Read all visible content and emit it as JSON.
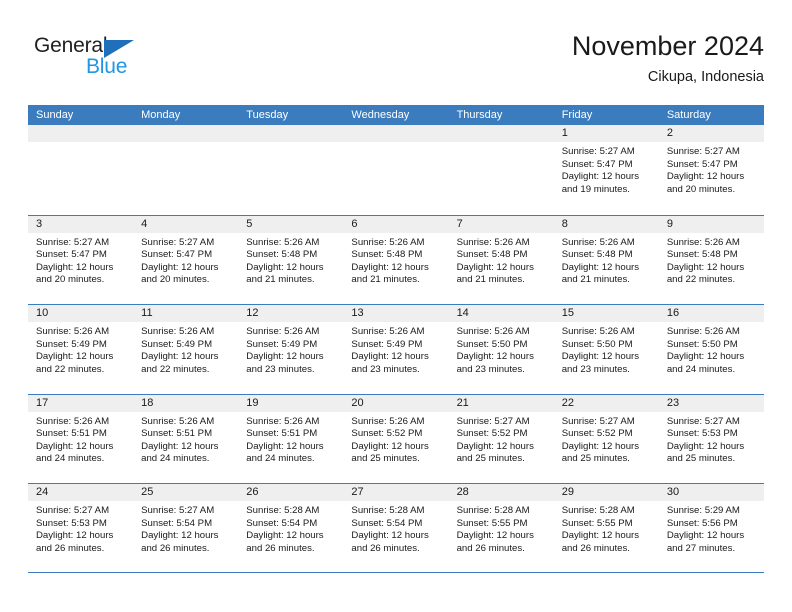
{
  "brand": {
    "name_part1": "General",
    "name_part2": "Blue",
    "triangle_color": "#1f6fba",
    "blue_color": "#2196e3"
  },
  "header": {
    "title": "November 2024",
    "subtitle": "Cikupa, Indonesia",
    "accent_color": "#3a7cbe",
    "day_band_color": "#efefef"
  },
  "weekdays": [
    "Sunday",
    "Monday",
    "Tuesday",
    "Wednesday",
    "Thursday",
    "Friday",
    "Saturday"
  ],
  "weeks": [
    [
      {
        "day": "",
        "empty": true,
        "sunrise": "",
        "sunset": "",
        "daylight_line1": "",
        "daylight_line2": ""
      },
      {
        "day": "",
        "empty": true,
        "sunrise": "",
        "sunset": "",
        "daylight_line1": "",
        "daylight_line2": ""
      },
      {
        "day": "",
        "empty": true,
        "sunrise": "",
        "sunset": "",
        "daylight_line1": "",
        "daylight_line2": ""
      },
      {
        "day": "",
        "empty": true,
        "sunrise": "",
        "sunset": "",
        "daylight_line1": "",
        "daylight_line2": ""
      },
      {
        "day": "",
        "empty": true,
        "sunrise": "",
        "sunset": "",
        "daylight_line1": "",
        "daylight_line2": ""
      },
      {
        "day": "1",
        "empty": false,
        "sunrise": "Sunrise: 5:27 AM",
        "sunset": "Sunset: 5:47 PM",
        "daylight_line1": "Daylight: 12 hours",
        "daylight_line2": "and 19 minutes."
      },
      {
        "day": "2",
        "empty": false,
        "sunrise": "Sunrise: 5:27 AM",
        "sunset": "Sunset: 5:47 PM",
        "daylight_line1": "Daylight: 12 hours",
        "daylight_line2": "and 20 minutes."
      }
    ],
    [
      {
        "day": "3",
        "empty": false,
        "sunrise": "Sunrise: 5:27 AM",
        "sunset": "Sunset: 5:47 PM",
        "daylight_line1": "Daylight: 12 hours",
        "daylight_line2": "and 20 minutes."
      },
      {
        "day": "4",
        "empty": false,
        "sunrise": "Sunrise: 5:27 AM",
        "sunset": "Sunset: 5:47 PM",
        "daylight_line1": "Daylight: 12 hours",
        "daylight_line2": "and 20 minutes."
      },
      {
        "day": "5",
        "empty": false,
        "sunrise": "Sunrise: 5:26 AM",
        "sunset": "Sunset: 5:48 PM",
        "daylight_line1": "Daylight: 12 hours",
        "daylight_line2": "and 21 minutes."
      },
      {
        "day": "6",
        "empty": false,
        "sunrise": "Sunrise: 5:26 AM",
        "sunset": "Sunset: 5:48 PM",
        "daylight_line1": "Daylight: 12 hours",
        "daylight_line2": "and 21 minutes."
      },
      {
        "day": "7",
        "empty": false,
        "sunrise": "Sunrise: 5:26 AM",
        "sunset": "Sunset: 5:48 PM",
        "daylight_line1": "Daylight: 12 hours",
        "daylight_line2": "and 21 minutes."
      },
      {
        "day": "8",
        "empty": false,
        "sunrise": "Sunrise: 5:26 AM",
        "sunset": "Sunset: 5:48 PM",
        "daylight_line1": "Daylight: 12 hours",
        "daylight_line2": "and 21 minutes."
      },
      {
        "day": "9",
        "empty": false,
        "sunrise": "Sunrise: 5:26 AM",
        "sunset": "Sunset: 5:48 PM",
        "daylight_line1": "Daylight: 12 hours",
        "daylight_line2": "and 22 minutes."
      }
    ],
    [
      {
        "day": "10",
        "empty": false,
        "sunrise": "Sunrise: 5:26 AM",
        "sunset": "Sunset: 5:49 PM",
        "daylight_line1": "Daylight: 12 hours",
        "daylight_line2": "and 22 minutes."
      },
      {
        "day": "11",
        "empty": false,
        "sunrise": "Sunrise: 5:26 AM",
        "sunset": "Sunset: 5:49 PM",
        "daylight_line1": "Daylight: 12 hours",
        "daylight_line2": "and 22 minutes."
      },
      {
        "day": "12",
        "empty": false,
        "sunrise": "Sunrise: 5:26 AM",
        "sunset": "Sunset: 5:49 PM",
        "daylight_line1": "Daylight: 12 hours",
        "daylight_line2": "and 23 minutes."
      },
      {
        "day": "13",
        "empty": false,
        "sunrise": "Sunrise: 5:26 AM",
        "sunset": "Sunset: 5:49 PM",
        "daylight_line1": "Daylight: 12 hours",
        "daylight_line2": "and 23 minutes."
      },
      {
        "day": "14",
        "empty": false,
        "sunrise": "Sunrise: 5:26 AM",
        "sunset": "Sunset: 5:50 PM",
        "daylight_line1": "Daylight: 12 hours",
        "daylight_line2": "and 23 minutes."
      },
      {
        "day": "15",
        "empty": false,
        "sunrise": "Sunrise: 5:26 AM",
        "sunset": "Sunset: 5:50 PM",
        "daylight_line1": "Daylight: 12 hours",
        "daylight_line2": "and 23 minutes."
      },
      {
        "day": "16",
        "empty": false,
        "sunrise": "Sunrise: 5:26 AM",
        "sunset": "Sunset: 5:50 PM",
        "daylight_line1": "Daylight: 12 hours",
        "daylight_line2": "and 24 minutes."
      }
    ],
    [
      {
        "day": "17",
        "empty": false,
        "sunrise": "Sunrise: 5:26 AM",
        "sunset": "Sunset: 5:51 PM",
        "daylight_line1": "Daylight: 12 hours",
        "daylight_line2": "and 24 minutes."
      },
      {
        "day": "18",
        "empty": false,
        "sunrise": "Sunrise: 5:26 AM",
        "sunset": "Sunset: 5:51 PM",
        "daylight_line1": "Daylight: 12 hours",
        "daylight_line2": "and 24 minutes."
      },
      {
        "day": "19",
        "empty": false,
        "sunrise": "Sunrise: 5:26 AM",
        "sunset": "Sunset: 5:51 PM",
        "daylight_line1": "Daylight: 12 hours",
        "daylight_line2": "and 24 minutes."
      },
      {
        "day": "20",
        "empty": false,
        "sunrise": "Sunrise: 5:26 AM",
        "sunset": "Sunset: 5:52 PM",
        "daylight_line1": "Daylight: 12 hours",
        "daylight_line2": "and 25 minutes."
      },
      {
        "day": "21",
        "empty": false,
        "sunrise": "Sunrise: 5:27 AM",
        "sunset": "Sunset: 5:52 PM",
        "daylight_line1": "Daylight: 12 hours",
        "daylight_line2": "and 25 minutes."
      },
      {
        "day": "22",
        "empty": false,
        "sunrise": "Sunrise: 5:27 AM",
        "sunset": "Sunset: 5:52 PM",
        "daylight_line1": "Daylight: 12 hours",
        "daylight_line2": "and 25 minutes."
      },
      {
        "day": "23",
        "empty": false,
        "sunrise": "Sunrise: 5:27 AM",
        "sunset": "Sunset: 5:53 PM",
        "daylight_line1": "Daylight: 12 hours",
        "daylight_line2": "and 25 minutes."
      }
    ],
    [
      {
        "day": "24",
        "empty": false,
        "sunrise": "Sunrise: 5:27 AM",
        "sunset": "Sunset: 5:53 PM",
        "daylight_line1": "Daylight: 12 hours",
        "daylight_line2": "and 26 minutes."
      },
      {
        "day": "25",
        "empty": false,
        "sunrise": "Sunrise: 5:27 AM",
        "sunset": "Sunset: 5:54 PM",
        "daylight_line1": "Daylight: 12 hours",
        "daylight_line2": "and 26 minutes."
      },
      {
        "day": "26",
        "empty": false,
        "sunrise": "Sunrise: 5:28 AM",
        "sunset": "Sunset: 5:54 PM",
        "daylight_line1": "Daylight: 12 hours",
        "daylight_line2": "and 26 minutes."
      },
      {
        "day": "27",
        "empty": false,
        "sunrise": "Sunrise: 5:28 AM",
        "sunset": "Sunset: 5:54 PM",
        "daylight_line1": "Daylight: 12 hours",
        "daylight_line2": "and 26 minutes."
      },
      {
        "day": "28",
        "empty": false,
        "sunrise": "Sunrise: 5:28 AM",
        "sunset": "Sunset: 5:55 PM",
        "daylight_line1": "Daylight: 12 hours",
        "daylight_line2": "and 26 minutes."
      },
      {
        "day": "29",
        "empty": false,
        "sunrise": "Sunrise: 5:28 AM",
        "sunset": "Sunset: 5:55 PM",
        "daylight_line1": "Daylight: 12 hours",
        "daylight_line2": "and 26 minutes."
      },
      {
        "day": "30",
        "empty": false,
        "sunrise": "Sunrise: 5:29 AM",
        "sunset": "Sunset: 5:56 PM",
        "daylight_line1": "Daylight: 12 hours",
        "daylight_line2": "and 27 minutes."
      }
    ]
  ]
}
